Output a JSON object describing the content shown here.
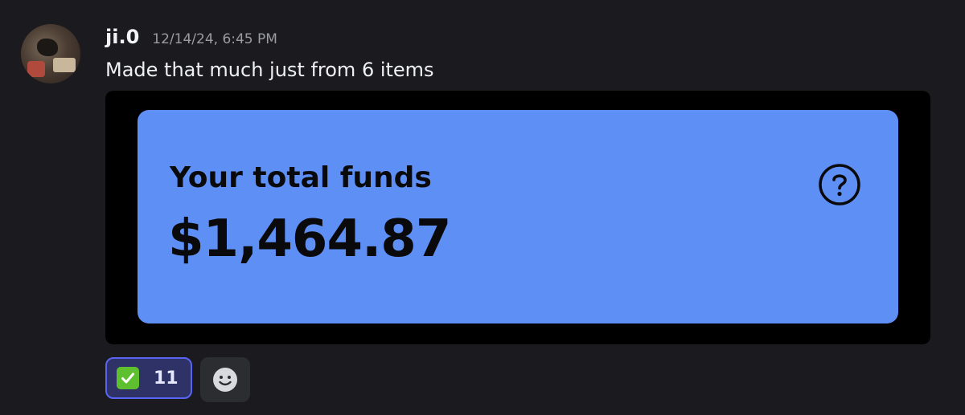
{
  "message": {
    "username": "ji.0",
    "timestamp": "12/14/24, 6:45 PM",
    "text": "Made that much just from 6 items"
  },
  "funds_card": {
    "label": "Your total funds",
    "amount": "$1,464.87",
    "help_icon": "question-circle-icon",
    "background_color": "#5e8ff5"
  },
  "reactions": [
    {
      "emoji": "check-mark-button-icon",
      "count": "11",
      "selected": true
    }
  ],
  "add_reaction": {
    "icon": "smiley-face-icon"
  }
}
